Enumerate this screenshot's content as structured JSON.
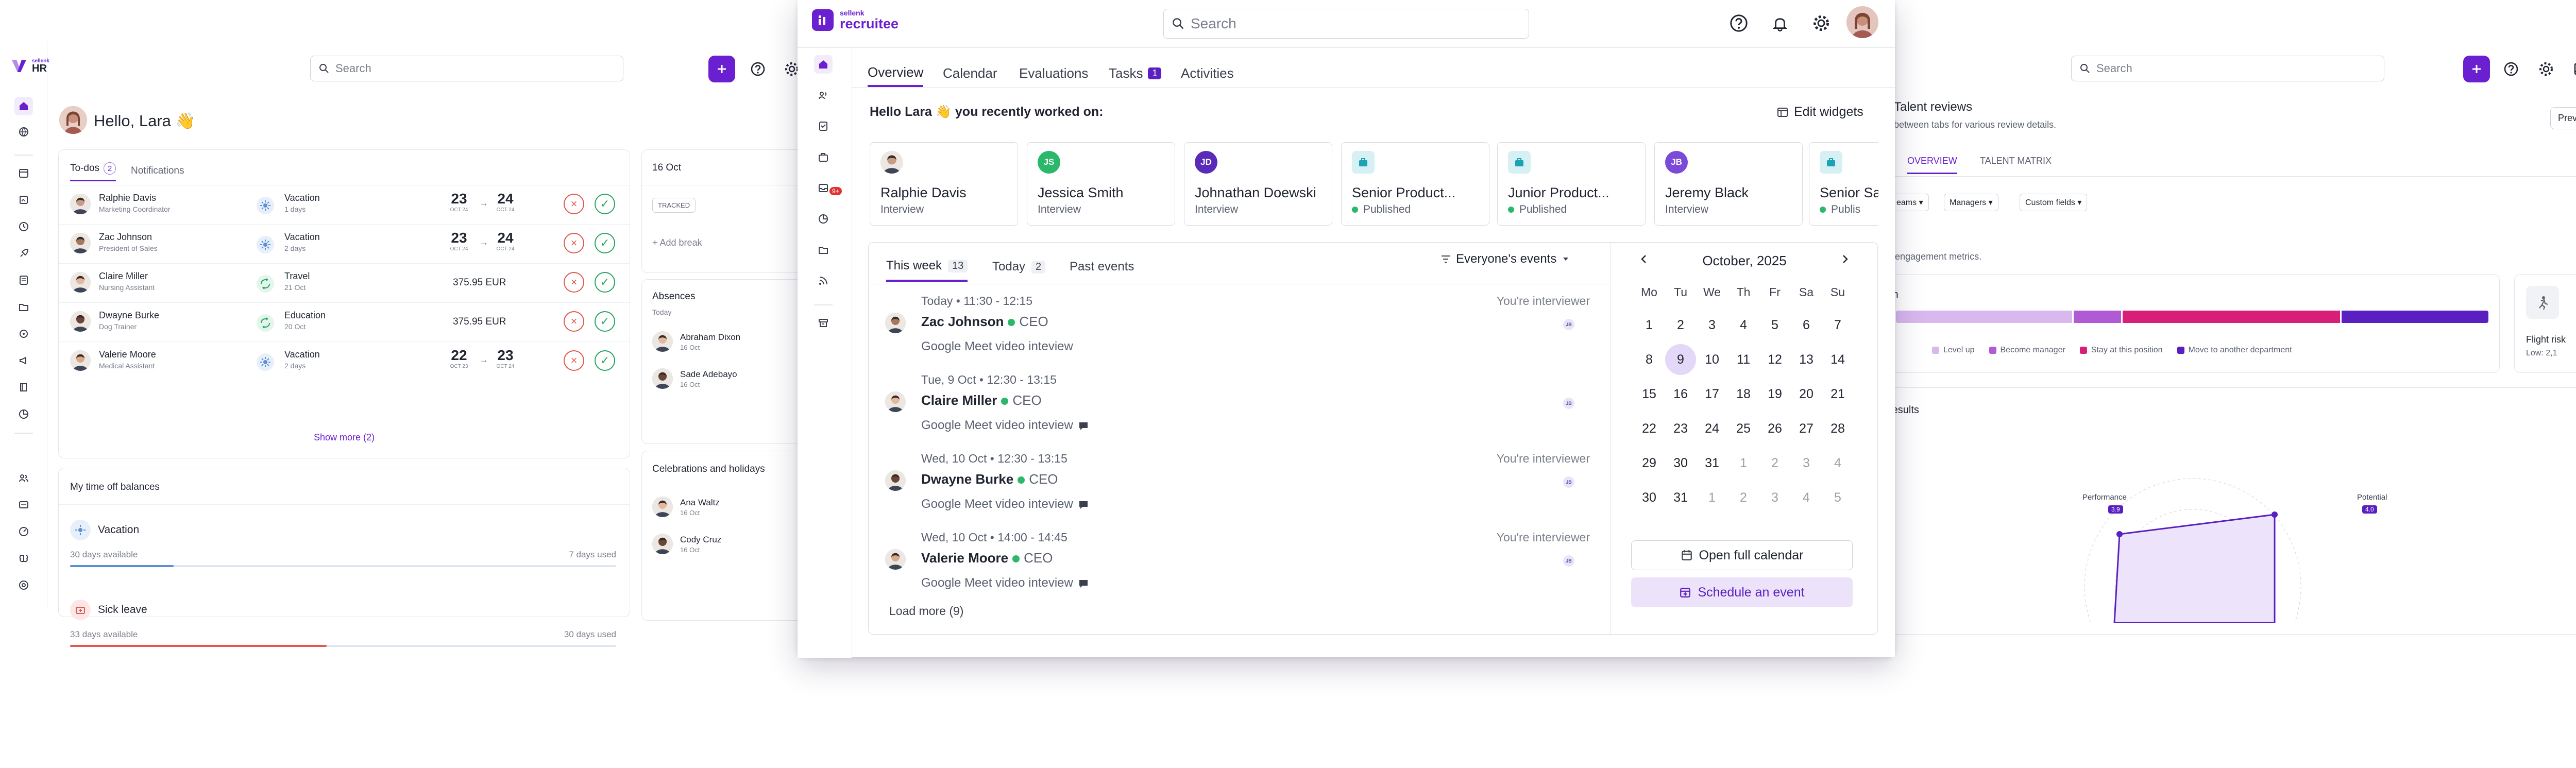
{
  "hr_app": {
    "logo_small": "sellenk",
    "logo_big": "HR",
    "search_placeholder": "Search",
    "greeting": "Hello, Lara 👋",
    "todo_tab": "To-dos",
    "todo_count": "2",
    "notifications_tab": "Notifications",
    "todos": [
      {
        "name": "Ralphie Davis",
        "role": "Marketing Coordinator",
        "type": "Vacation",
        "dur": "1 days",
        "from_d": "23",
        "from_m": "OCT 24",
        "to_d": "24",
        "to_m": "OCT 24",
        "amount": ""
      },
      {
        "name": "Zac Johnson",
        "role": "President of Sales",
        "type": "Vacation",
        "dur": "2 days",
        "from_d": "23",
        "from_m": "OCT 24",
        "to_d": "24",
        "to_m": "OCT 24",
        "amount": ""
      },
      {
        "name": "Claire Miller",
        "role": "Nursing Assistant",
        "type": "Travel",
        "dur": "21 Oct",
        "from_d": "",
        "from_m": "",
        "to_d": "",
        "to_m": "",
        "amount": "375.95 EUR"
      },
      {
        "name": "Dwayne Burke",
        "role": "Dog Trainer",
        "type": "Education",
        "dur": "20 Oct",
        "from_d": "",
        "from_m": "",
        "to_d": "",
        "to_m": "",
        "amount": "375.95 EUR"
      },
      {
        "name": "Valerie Moore",
        "role": "Medical Assistant",
        "type": "Vacation",
        "dur": "2 days",
        "from_d": "22",
        "from_m": "OCT 23",
        "to_d": "23",
        "to_m": "OCT 24",
        "amount": ""
      }
    ],
    "show_more": "Show more (2)",
    "balances_title": "My time off balances",
    "balances": [
      {
        "name": "Vacation",
        "available": "30 days available",
        "used": "7 days used",
        "fill": 0.19
      },
      {
        "name": "Sick leave",
        "available": "33 days available",
        "used": "30 days used",
        "fill": 0.47
      }
    ],
    "mid_date": "16 Oct",
    "tracked": "TRACKED",
    "add_break": "+ Add break",
    "absences_title": "Absences",
    "absences_sub": "Today",
    "absences": [
      {
        "name": "Abraham Dixon",
        "date": "16 Oct"
      },
      {
        "name": "Sade Adebayo",
        "date": "16 Oct"
      }
    ],
    "celebrations_title": "Celebrations and holidays",
    "celebrations": [
      {
        "name": "Ana Waltz",
        "date": "16 Oct"
      },
      {
        "name": "Cody Cruz",
        "date": "16 Oct"
      }
    ]
  },
  "talent_app": {
    "search_placeholder": "Search",
    "title": "Talent reviews",
    "subtitle": "between tabs for various review details.",
    "preview_button": "Preview form template",
    "tabs": [
      "OVERVIEW",
      "TALENT MATRIX"
    ],
    "filters": [
      "eams",
      "Managers",
      "Custom fields"
    ],
    "engagement": "y engagement metrics.",
    "bar_title": "th",
    "segments": [
      {
        "label": "Level up",
        "color": "#d9b8f0",
        "value": 0.3
      },
      {
        "label": "Become manager",
        "color": "#b05ad6",
        "value": 0.08
      },
      {
        "label": "Stay at this position",
        "color": "#d91e78",
        "value": 0.37
      },
      {
        "label": "Move to another department",
        "color": "#5a1fc0",
        "value": 0.25
      }
    ],
    "flight_risk": "Flight risk",
    "flight_low": "Low: 2,1",
    "results_title": "results",
    "radar_labels": [
      {
        "name": "Performance",
        "value": "3.9"
      },
      {
        "name": "Potential",
        "value": "4.0"
      }
    ]
  },
  "recruitee": {
    "logo_small": "sellenk",
    "logo_big": "recruitee",
    "search_placeholder": "Search",
    "tabs": [
      {
        "label": "Overview"
      },
      {
        "label": "Calendar"
      },
      {
        "label": "Evaluations"
      },
      {
        "label": "Tasks",
        "badge": "1"
      },
      {
        "label": "Activities"
      }
    ],
    "inbox_badge": "9+",
    "worked_on": "Hello Lara 👋 you recently worked on:",
    "edit_widgets": "Edit widgets",
    "recent": [
      {
        "name": "Ralphie Davis",
        "status": "Interview",
        "kind": "photo"
      },
      {
        "name": "Jessica Smith",
        "status": "Interview",
        "kind": "initials",
        "initials": "JS",
        "color": "#2cb86a"
      },
      {
        "name": "Johnathan Doewski",
        "status": "Interview",
        "kind": "initials",
        "initials": "JD",
        "color": "#5a2bb8"
      },
      {
        "name": "Senior Product...",
        "status": "Published",
        "kind": "job"
      },
      {
        "name": "Junior Product...",
        "status": "Published",
        "kind": "job"
      },
      {
        "name": "Jeremy Black",
        "status": "Interview",
        "kind": "initials",
        "initials": "JB",
        "color": "#7c4ad9"
      },
      {
        "name": "Senior Sa",
        "status": "Publis",
        "kind": "job"
      }
    ],
    "events_tabs": [
      {
        "label": "This week",
        "count": "13"
      },
      {
        "label": "Today",
        "count": "2"
      },
      {
        "label": "Past events",
        "count": ""
      }
    ],
    "everyone_events": "Everyone's events",
    "events": [
      {
        "time": "Today • 11:30 - 12:15",
        "name": "Zac Johnson",
        "role": "CEO",
        "desc": "Google Meet video inteview",
        "right": "You're interviewer",
        "note": false
      },
      {
        "time": "Tue, 9 Oct • 12:30 - 13:15",
        "name": "Claire Miller",
        "role": "CEO",
        "desc": "Google Meet video inteview",
        "right": "",
        "note": true
      },
      {
        "time": "Wed, 10 Oct • 12:30 - 13:15",
        "name": "Dwayne Burke",
        "role": "CEO",
        "desc": "Google Meet video inteview",
        "right": "You're interviewer",
        "note": true
      },
      {
        "time": "Wed, 10 Oct • 14:00 - 14:45",
        "name": "Valerie Moore",
        "role": "CEO",
        "desc": "Google Meet video inteview",
        "right": "You're interviewer",
        "note": true
      }
    ],
    "event_initials": "JB",
    "load_more": "Load more (9)",
    "calendar": {
      "month": "October, 2025",
      "weekdays": [
        "Mo",
        "Tu",
        "We",
        "Th",
        "Fr",
        "Sa",
        "Su"
      ],
      "weeks": [
        [
          "1",
          "2",
          "3",
          "4",
          "5",
          "6",
          "7"
        ],
        [
          "8",
          "9",
          "10",
          "11",
          "12",
          "13",
          "14"
        ],
        [
          "15",
          "16",
          "17",
          "18",
          "19",
          "20",
          "21"
        ],
        [
          "22",
          "23",
          "24",
          "25",
          "26",
          "27",
          "28"
        ],
        [
          "29",
          "30",
          "31",
          "1",
          "2",
          "3",
          "4"
        ],
        [
          "30",
          "31",
          "1",
          "2",
          "3",
          "4",
          "5"
        ]
      ],
      "today": "9",
      "open_full": "Open full calendar",
      "schedule": "Schedule an event"
    }
  },
  "colors": {
    "brand": "#6a1fd0",
    "accent_soft": "#efe7fb",
    "green": "#2cb86a",
    "red": "#e25a4e"
  }
}
